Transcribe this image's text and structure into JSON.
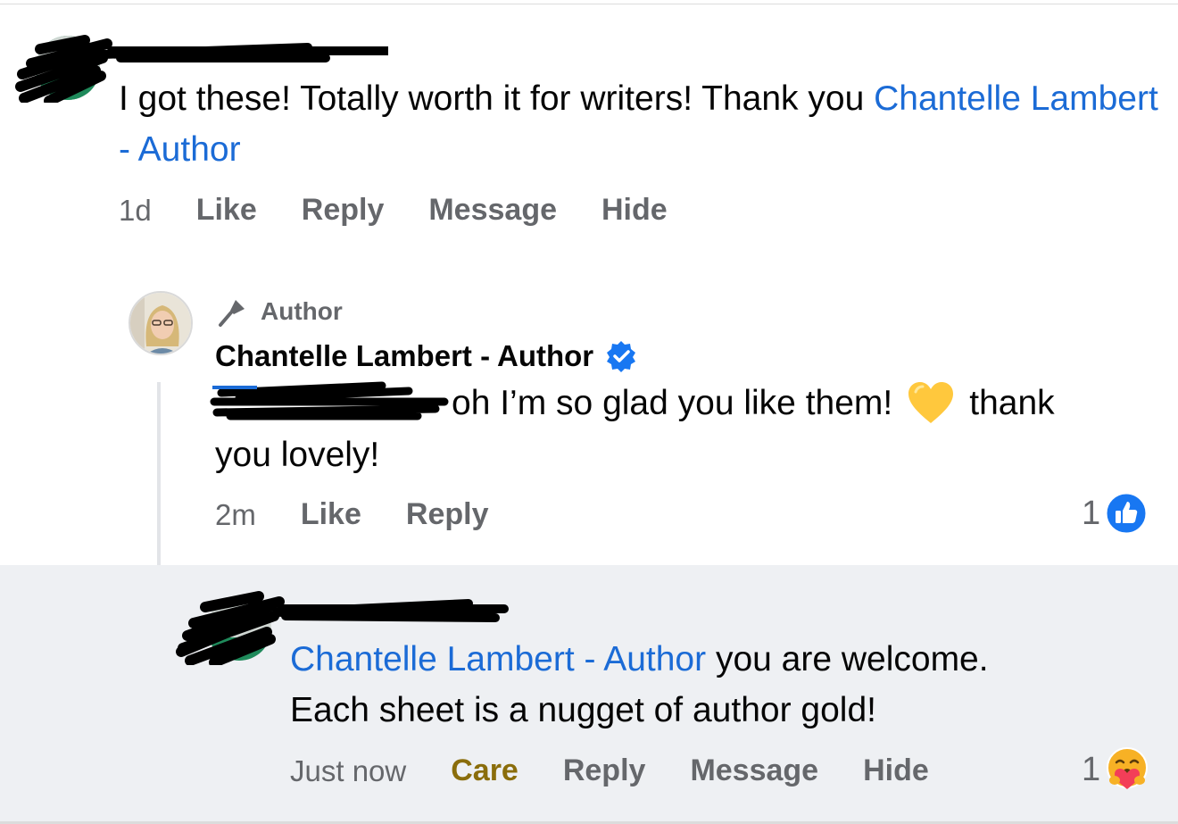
{
  "comment1": {
    "text_before": "I got these! Totally worth it for writers! Thank you ",
    "mention": "Chantelle Lambert - Author",
    "actions": {
      "time": "1d",
      "like": "Like",
      "reply": "Reply",
      "message": "Message",
      "hide": "Hide"
    }
  },
  "reply1": {
    "badge": "Author",
    "name": "Chantelle Lambert - Author",
    "text_a": "oh I’m so glad you like them!",
    "text_b": "thank",
    "text_c": "you lovely!",
    "actions": {
      "time": "2m",
      "like": "Like",
      "reply": "Reply"
    },
    "reaction_count": "1"
  },
  "reply2": {
    "mention": "Chantelle Lambert - Author",
    "text_a": " you are welcome.",
    "text_b": "Each sheet is a nugget of author gold!",
    "actions": {
      "time": "Just now",
      "care": "Care",
      "reply": "Reply",
      "message": "Message",
      "hide": "Hide"
    },
    "reaction_count": "1"
  },
  "colors": {
    "link": "#1b6bd6",
    "care": "#8a6d0b",
    "meta": "#65676b",
    "highlight_bg": "#eef0f3"
  },
  "icons": [
    "verified-badge-icon",
    "author-microphone-icon",
    "yellow-heart-emoji",
    "like-reaction-icon",
    "care-reaction-icon"
  ]
}
